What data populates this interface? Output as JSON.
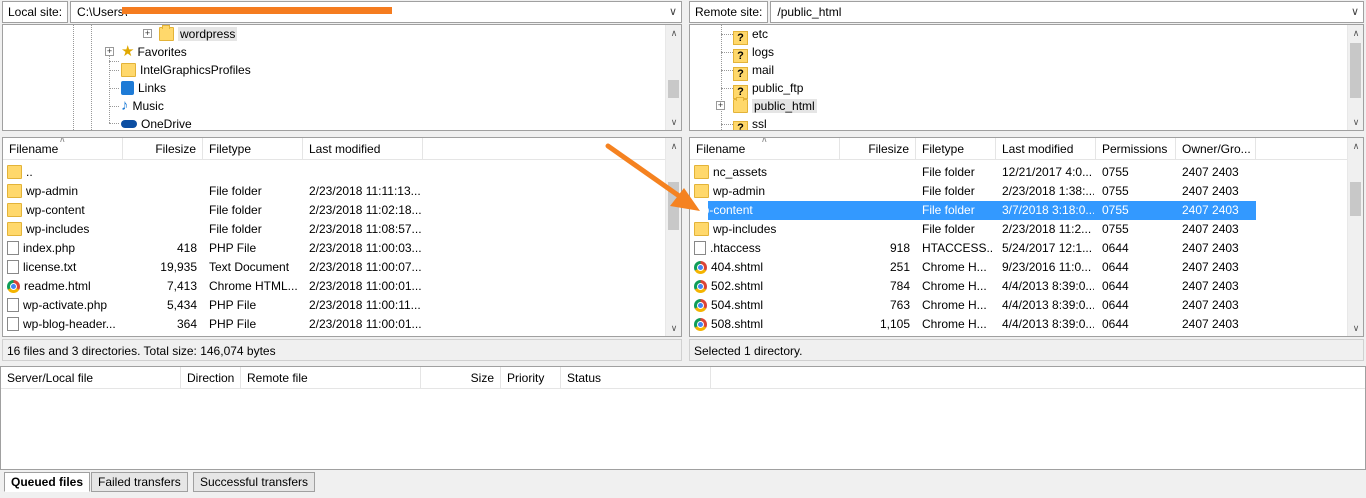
{
  "local": {
    "site_label": "Local site:",
    "path": "C:\\Users\\",
    "tree": [
      {
        "label": "wordpress",
        "icon": "folder-icon",
        "indent": 3
      },
      {
        "label": "Favorites",
        "icon": "star-icon",
        "indent": 2
      },
      {
        "label": "IntelGraphicsProfiles",
        "icon": "folder-icon",
        "indent": 2
      },
      {
        "label": "Links",
        "icon": "links-icon",
        "indent": 2
      },
      {
        "label": "Music",
        "icon": "music-icon",
        "indent": 2
      },
      {
        "label": "OneDrive",
        "icon": "onedrive-icon",
        "indent": 2
      }
    ],
    "columns": [
      "Filename",
      "Filesize",
      "Filetype",
      "Last modified"
    ],
    "files": [
      {
        "name": "..",
        "size": "",
        "type": "",
        "modified": "",
        "icon": "folder"
      },
      {
        "name": "wp-admin",
        "size": "",
        "type": "File folder",
        "modified": "2/23/2018 11:11:13...",
        "icon": "folder"
      },
      {
        "name": "wp-content",
        "size": "",
        "type": "File folder",
        "modified": "2/23/2018 11:02:18...",
        "icon": "folder"
      },
      {
        "name": "wp-includes",
        "size": "",
        "type": "File folder",
        "modified": "2/23/2018 11:08:57...",
        "icon": "folder"
      },
      {
        "name": "index.php",
        "size": "418",
        "type": "PHP File",
        "modified": "2/23/2018 11:00:03...",
        "icon": "file"
      },
      {
        "name": "license.txt",
        "size": "19,935",
        "type": "Text Document",
        "modified": "2/23/2018 11:00:07...",
        "icon": "file"
      },
      {
        "name": "readme.html",
        "size": "7,413",
        "type": "Chrome HTML...",
        "modified": "2/23/2018 11:00:01...",
        "icon": "chrome"
      },
      {
        "name": "wp-activate.php",
        "size": "5,434",
        "type": "PHP File",
        "modified": "2/23/2018 11:00:11...",
        "icon": "file"
      },
      {
        "name": "wp-blog-header...",
        "size": "364",
        "type": "PHP File",
        "modified": "2/23/2018 11:00:01...",
        "icon": "file"
      }
    ],
    "status": "16 files and 3 directories. Total size: 146,074 bytes"
  },
  "remote": {
    "site_label": "Remote site:",
    "path": "/public_html",
    "tree": [
      {
        "label": "etc"
      },
      {
        "label": "logs"
      },
      {
        "label": "mail"
      },
      {
        "label": "public_ftp"
      },
      {
        "label": "public_html"
      },
      {
        "label": "ssl"
      }
    ],
    "columns": [
      "Filename",
      "Filesize",
      "Filetype",
      "Last modified",
      "Permissions",
      "Owner/Gro..."
    ],
    "files": [
      {
        "name": "nc_assets",
        "size": "",
        "type": "File folder",
        "modified": "12/21/2017 4:0...",
        "perm": "0755",
        "owner": "2407 2403",
        "icon": "folder"
      },
      {
        "name": "wp-admin",
        "size": "",
        "type": "File folder",
        "modified": "2/23/2018 1:38:...",
        "perm": "0755",
        "owner": "2407 2403",
        "icon": "folder"
      },
      {
        "name": "wp-content",
        "size": "",
        "type": "File folder",
        "modified": "3/7/2018 3:18:0...",
        "perm": "0755",
        "owner": "2407 2403",
        "icon": "folder",
        "selected": true
      },
      {
        "name": "wp-includes",
        "size": "",
        "type": "File folder",
        "modified": "2/23/2018 11:2...",
        "perm": "0755",
        "owner": "2407 2403",
        "icon": "folder"
      },
      {
        "name": ".htaccess",
        "size": "918",
        "type": "HTACCESS...",
        "modified": "5/24/2017 12:1...",
        "perm": "0644",
        "owner": "2407 2403",
        "icon": "file"
      },
      {
        "name": "404.shtml",
        "size": "251",
        "type": "Chrome H...",
        "modified": "9/23/2016 11:0...",
        "perm": "0644",
        "owner": "2407 2403",
        "icon": "chrome"
      },
      {
        "name": "502.shtml",
        "size": "784",
        "type": "Chrome H...",
        "modified": "4/4/2013 8:39:0...",
        "perm": "0644",
        "owner": "2407 2403",
        "icon": "chrome"
      },
      {
        "name": "504.shtml",
        "size": "763",
        "type": "Chrome H...",
        "modified": "4/4/2013 8:39:0...",
        "perm": "0644",
        "owner": "2407 2403",
        "icon": "chrome"
      },
      {
        "name": "508.shtml",
        "size": "1,105",
        "type": "Chrome H...",
        "modified": "4/4/2013 8:39:0...",
        "perm": "0644",
        "owner": "2407 2403",
        "icon": "chrome"
      }
    ],
    "status": "Selected 1 directory."
  },
  "queue": {
    "columns": [
      "Server/Local file",
      "Direction",
      "Remote file",
      "Size",
      "Priority",
      "Status"
    ]
  },
  "tabs": [
    "Queued files",
    "Failed transfers",
    "Successful transfers"
  ],
  "colors": {
    "selection": "#3399ff",
    "arrow": "#f58220",
    "redaction": "#f57c1f"
  }
}
